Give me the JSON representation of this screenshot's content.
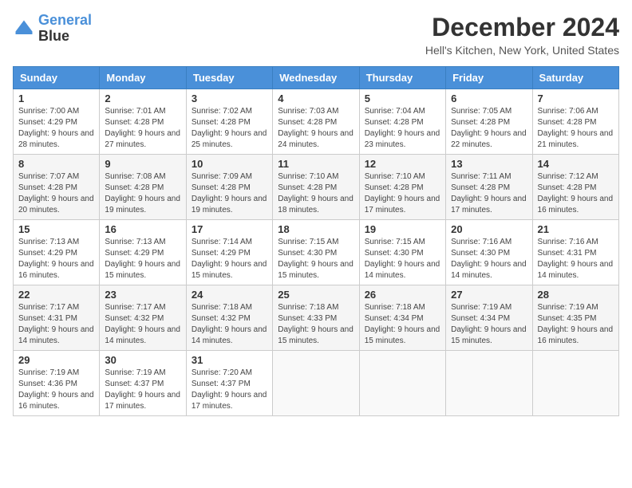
{
  "logo": {
    "line1": "General",
    "line2": "Blue"
  },
  "header": {
    "title": "December 2024",
    "location": "Hell's Kitchen, New York, United States"
  },
  "days_of_week": [
    "Sunday",
    "Monday",
    "Tuesday",
    "Wednesday",
    "Thursday",
    "Friday",
    "Saturday"
  ],
  "weeks": [
    [
      {
        "day": "1",
        "sunrise": "7:00 AM",
        "sunset": "4:29 PM",
        "daylight_hours": "9",
        "daylight_minutes": "28"
      },
      {
        "day": "2",
        "sunrise": "7:01 AM",
        "sunset": "4:28 PM",
        "daylight_hours": "9",
        "daylight_minutes": "27"
      },
      {
        "day": "3",
        "sunrise": "7:02 AM",
        "sunset": "4:28 PM",
        "daylight_hours": "9",
        "daylight_minutes": "25"
      },
      {
        "day": "4",
        "sunrise": "7:03 AM",
        "sunset": "4:28 PM",
        "daylight_hours": "9",
        "daylight_minutes": "24"
      },
      {
        "day": "5",
        "sunrise": "7:04 AM",
        "sunset": "4:28 PM",
        "daylight_hours": "9",
        "daylight_minutes": "23"
      },
      {
        "day": "6",
        "sunrise": "7:05 AM",
        "sunset": "4:28 PM",
        "daylight_hours": "9",
        "daylight_minutes": "22"
      },
      {
        "day": "7",
        "sunrise": "7:06 AM",
        "sunset": "4:28 PM",
        "daylight_hours": "9",
        "daylight_minutes": "21"
      }
    ],
    [
      {
        "day": "8",
        "sunrise": "7:07 AM",
        "sunset": "4:28 PM",
        "daylight_hours": "9",
        "daylight_minutes": "20"
      },
      {
        "day": "9",
        "sunrise": "7:08 AM",
        "sunset": "4:28 PM",
        "daylight_hours": "9",
        "daylight_minutes": "19"
      },
      {
        "day": "10",
        "sunrise": "7:09 AM",
        "sunset": "4:28 PM",
        "daylight_hours": "9",
        "daylight_minutes": "19"
      },
      {
        "day": "11",
        "sunrise": "7:10 AM",
        "sunset": "4:28 PM",
        "daylight_hours": "9",
        "daylight_minutes": "18"
      },
      {
        "day": "12",
        "sunrise": "7:10 AM",
        "sunset": "4:28 PM",
        "daylight_hours": "9",
        "daylight_minutes": "17"
      },
      {
        "day": "13",
        "sunrise": "7:11 AM",
        "sunset": "4:28 PM",
        "daylight_hours": "9",
        "daylight_minutes": "17"
      },
      {
        "day": "14",
        "sunrise": "7:12 AM",
        "sunset": "4:28 PM",
        "daylight_hours": "9",
        "daylight_minutes": "16"
      }
    ],
    [
      {
        "day": "15",
        "sunrise": "7:13 AM",
        "sunset": "4:29 PM",
        "daylight_hours": "9",
        "daylight_minutes": "16"
      },
      {
        "day": "16",
        "sunrise": "7:13 AM",
        "sunset": "4:29 PM",
        "daylight_hours": "9",
        "daylight_minutes": "15"
      },
      {
        "day": "17",
        "sunrise": "7:14 AM",
        "sunset": "4:29 PM",
        "daylight_hours": "9",
        "daylight_minutes": "15"
      },
      {
        "day": "18",
        "sunrise": "7:15 AM",
        "sunset": "4:30 PM",
        "daylight_hours": "9",
        "daylight_minutes": "15"
      },
      {
        "day": "19",
        "sunrise": "7:15 AM",
        "sunset": "4:30 PM",
        "daylight_hours": "9",
        "daylight_minutes": "14"
      },
      {
        "day": "20",
        "sunrise": "7:16 AM",
        "sunset": "4:30 PM",
        "daylight_hours": "9",
        "daylight_minutes": "14"
      },
      {
        "day": "21",
        "sunrise": "7:16 AM",
        "sunset": "4:31 PM",
        "daylight_hours": "9",
        "daylight_minutes": "14"
      }
    ],
    [
      {
        "day": "22",
        "sunrise": "7:17 AM",
        "sunset": "4:31 PM",
        "daylight_hours": "9",
        "daylight_minutes": "14"
      },
      {
        "day": "23",
        "sunrise": "7:17 AM",
        "sunset": "4:32 PM",
        "daylight_hours": "9",
        "daylight_minutes": "14"
      },
      {
        "day": "24",
        "sunrise": "7:18 AM",
        "sunset": "4:32 PM",
        "daylight_hours": "9",
        "daylight_minutes": "14"
      },
      {
        "day": "25",
        "sunrise": "7:18 AM",
        "sunset": "4:33 PM",
        "daylight_hours": "9",
        "daylight_minutes": "15"
      },
      {
        "day": "26",
        "sunrise": "7:18 AM",
        "sunset": "4:34 PM",
        "daylight_hours": "9",
        "daylight_minutes": "15"
      },
      {
        "day": "27",
        "sunrise": "7:19 AM",
        "sunset": "4:34 PM",
        "daylight_hours": "9",
        "daylight_minutes": "15"
      },
      {
        "day": "28",
        "sunrise": "7:19 AM",
        "sunset": "4:35 PM",
        "daylight_hours": "9",
        "daylight_minutes": "16"
      }
    ],
    [
      {
        "day": "29",
        "sunrise": "7:19 AM",
        "sunset": "4:36 PM",
        "daylight_hours": "9",
        "daylight_minutes": "16"
      },
      {
        "day": "30",
        "sunrise": "7:19 AM",
        "sunset": "4:37 PM",
        "daylight_hours": "9",
        "daylight_minutes": "17"
      },
      {
        "day": "31",
        "sunrise": "7:20 AM",
        "sunset": "4:37 PM",
        "daylight_hours": "9",
        "daylight_minutes": "17"
      },
      null,
      null,
      null,
      null
    ]
  ]
}
